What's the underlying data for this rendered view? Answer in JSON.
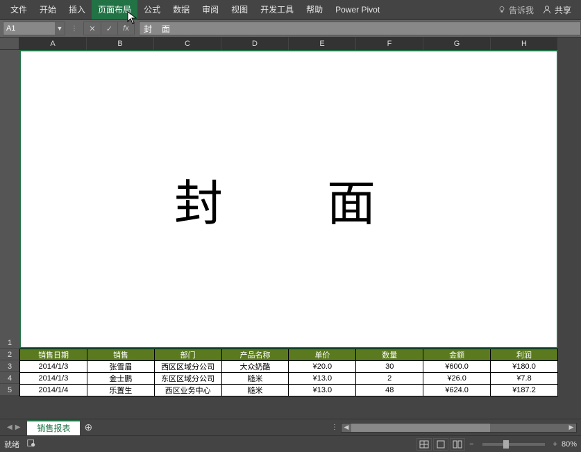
{
  "ribbon": {
    "tabs": [
      "文件",
      "开始",
      "插入",
      "页面布局",
      "公式",
      "数据",
      "审阅",
      "视图",
      "开发工具",
      "帮助",
      "Power Pivot"
    ],
    "active_index": 3,
    "tell_me_placeholder": "告诉我",
    "share_label": "共享"
  },
  "namebox": {
    "value": "A1"
  },
  "formula_bar": {
    "value": "封　面"
  },
  "columns": [
    "A",
    "B",
    "C",
    "D",
    "E",
    "F",
    "G",
    "H"
  ],
  "rows": [
    "1",
    "2",
    "3",
    "4",
    "5"
  ],
  "cover_cell_text": "封　面",
  "table": {
    "headers": [
      "销售日期",
      "销售",
      "部门",
      "产品名称",
      "单价",
      "数量",
      "金额",
      "利润"
    ],
    "rows": [
      [
        "2014/1/3",
        "张雪眉",
        "西区区域分公司",
        "大众奶酪",
        "¥20.0",
        "30",
        "¥600.0",
        "¥180.0"
      ],
      [
        "2014/1/3",
        "金士鹏",
        "东区区域分公司",
        "糙米",
        "¥13.0",
        "2",
        "¥26.0",
        "¥7.8"
      ],
      [
        "2014/1/4",
        "乐置生",
        "西区业务中心",
        "糙米",
        "¥13.0",
        "48",
        "¥624.0",
        "¥187.2"
      ]
    ]
  },
  "sheet_tabs": {
    "active": "销售报表"
  },
  "status": {
    "ready": "就绪",
    "zoom": "80%"
  }
}
